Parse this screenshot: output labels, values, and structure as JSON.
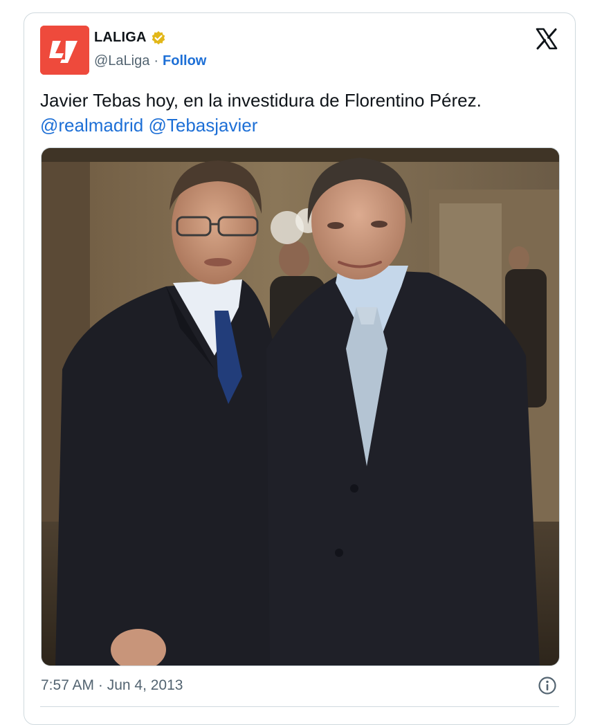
{
  "author": {
    "display_name": "LALIGA",
    "handle": "@LaLiga",
    "separator": "·",
    "follow_label": "Follow",
    "verified": true
  },
  "tweet": {
    "text": "Javier Tebas hoy, en la investidura de Florentino Pérez.",
    "mentions": [
      "@realmadrid",
      "@Tebasjavier"
    ],
    "timestamp": "7:57 AM · Jun 4, 2013"
  },
  "icons": {
    "brand": "x-logo-icon",
    "verified": "verified-badge-icon",
    "info": "info-icon"
  },
  "colors": {
    "link": "#1d6fd6",
    "secondary_text": "#536471",
    "avatar_bg": "#ee4a3c",
    "verified_badge": "#e2b719",
    "border": "#cfd9de"
  }
}
